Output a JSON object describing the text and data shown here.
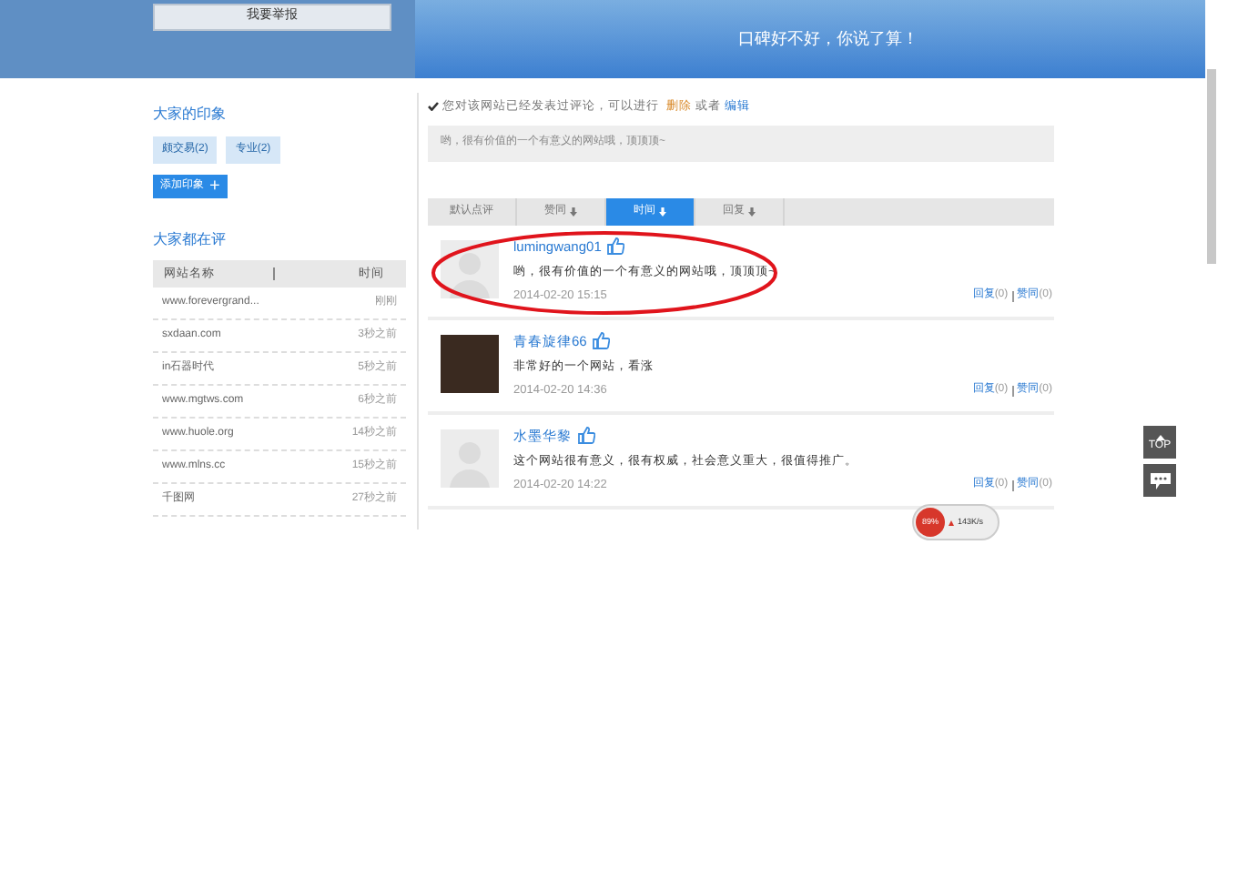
{
  "header": {
    "report_button": "我要举报",
    "slogan": "口碑好不好，你说了算！"
  },
  "impressions": {
    "title": "大家的印象",
    "tags": [
      {
        "label": "颇交易(2)"
      },
      {
        "label": "专业(2)"
      }
    ],
    "add_button": "添加印象",
    "add_icon": "+"
  },
  "recent": {
    "title": "大家都在评",
    "columns": [
      "网站名称",
      "时间"
    ],
    "rows": [
      [
        "www.forevergrand...",
        "刚刚"
      ],
      [
        "sxdaan.com",
        "3秒之前"
      ],
      [
        "in石器时代",
        "5秒之前"
      ],
      [
        "www.mgtws.com",
        "6秒之前"
      ],
      [
        "www.huole.org",
        "14秒之前"
      ],
      [
        "www.mlns.cc",
        "15秒之前"
      ],
      [
        "千图网",
        "27秒之前"
      ]
    ]
  },
  "notice": {
    "text": "您对该网站已经发表过评论，可以进行",
    "delete": "删除",
    "or": "或者",
    "edit": "编辑"
  },
  "my_comment": "哟，很有价值的一个有意义的网站哦，顶顶顶~",
  "sort_tabs": [
    {
      "label": "默认点评",
      "arrow": false,
      "selected": false
    },
    {
      "label": "赞同",
      "arrow": true,
      "selected": false
    },
    {
      "label": "时间",
      "arrow": true,
      "selected": true
    },
    {
      "label": "回复",
      "arrow": true,
      "selected": false
    }
  ],
  "comments": [
    {
      "user": "lumingwang01",
      "photo": false,
      "text": "哟，很有价值的一个有意义的网站哦，顶顶顶~",
      "time": "2014-02-20 15:15",
      "reply": "回复",
      "reply_count": "(0)",
      "like": "赞同",
      "like_count": "(0)",
      "highlighted": true
    },
    {
      "user": "青春旋律66",
      "photo": true,
      "text": "非常好的一个网站，看涨",
      "time": "2014-02-20 14:36",
      "reply": "回复",
      "reply_count": "(0)",
      "like": "赞同",
      "like_count": "(0)",
      "highlighted": false
    },
    {
      "user": "水墨华黎",
      "photo": false,
      "text": "这个网站很有意义，很有权威，社会意义重大，很值得推广。",
      "time": "2014-02-20 14:22",
      "reply": "回复",
      "reply_count": "(0)",
      "like": "赞同",
      "like_count": "(0)",
      "highlighted": false
    }
  ],
  "float_tools": {
    "top": "TOP"
  },
  "speed_widget": {
    "percent": "89%",
    "upload": "143K/s"
  }
}
